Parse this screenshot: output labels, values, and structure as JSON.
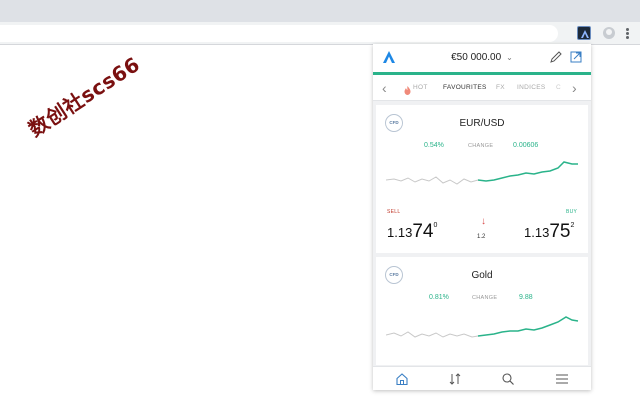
{
  "browser": {
    "extension_icon": "app-logo-icon",
    "profile_icon": "profile-avatar-icon",
    "menu_icon": "kebab-menu-icon"
  },
  "watermark": {
    "text": "数创社scs66",
    "color": "#7a1010"
  },
  "popup": {
    "header": {
      "logo_icon": "app-logo-icon",
      "balance": "€50 000.00",
      "balance_icon": "chevron-down-icon",
      "edit_icon": "pencil-icon",
      "popout_icon": "external-link-icon"
    },
    "accent_color": "#2ab38a",
    "tabs": [
      {
        "label": "HOT",
        "icon": "flame-icon",
        "active": false
      },
      {
        "label": "FAVOURITES",
        "active": true
      },
      {
        "label": "FX",
        "active": false
      },
      {
        "label": "INDICES",
        "active": false
      },
      {
        "label": "C",
        "active": false
      }
    ],
    "cards": [
      {
        "badge": "CFD",
        "title": "EUR/USD",
        "change_pct": "0.54%",
        "change_label": "CHANGE",
        "change_value": "0.00606",
        "sell_label": "SELL",
        "buy_label": "BUY",
        "sell_price": {
          "head": "1.13",
          "big": "74",
          "sup": "0"
        },
        "buy_price": {
          "head": "1.13",
          "big": "75",
          "sup": "2"
        },
        "spread": "1.2",
        "spread_icon": "arrow-down-icon"
      },
      {
        "badge": "CFD",
        "title": "Gold",
        "change_pct": "0.81%",
        "change_label": "CHANGE",
        "change_value": "9.88"
      }
    ],
    "nav": [
      {
        "icon": "home-icon",
        "active": true
      },
      {
        "icon": "transfer-arrows-icon",
        "active": false
      },
      {
        "icon": "search-icon",
        "active": false
      },
      {
        "icon": "hamburger-menu-icon",
        "active": false
      }
    ],
    "colors": {
      "positive": "#2ab38a",
      "negative": "#d84a4a",
      "active_nav": "#3a7fc4"
    }
  }
}
